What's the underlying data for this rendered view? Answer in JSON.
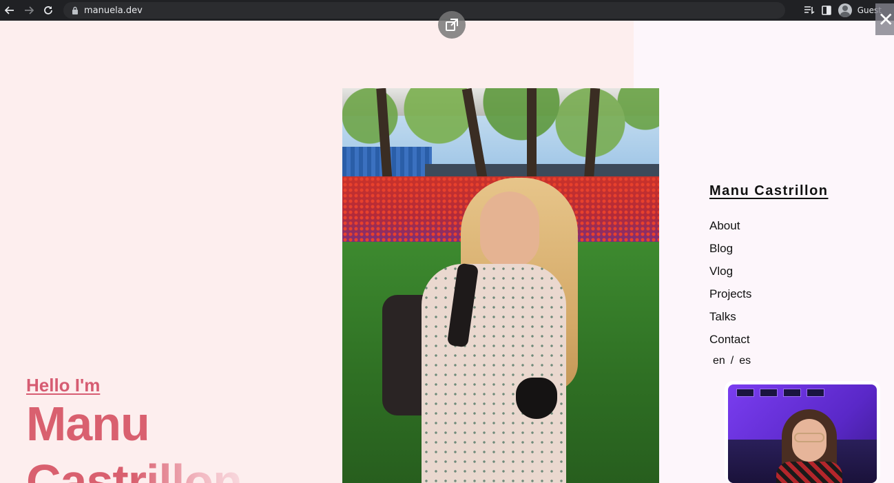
{
  "browser": {
    "url": "manuela.dev",
    "profile_label": "Guest"
  },
  "hero": {
    "greeting": "Hello I'm",
    "name_line1": "Manu",
    "name_line2": "Castrillon",
    "accent_color": "#d9606f",
    "panel_color": "#fdeeee"
  },
  "nav": {
    "site_title": "Manu Castrillon",
    "items": [
      "About",
      "Blog",
      "Vlog",
      "Projects",
      "Talks",
      "Contact"
    ],
    "languages": [
      "en",
      "es"
    ],
    "lang_separator": "/"
  },
  "overlay": {
    "expand_icon": "open-in-new-icon",
    "close_icon": "close-icon"
  }
}
